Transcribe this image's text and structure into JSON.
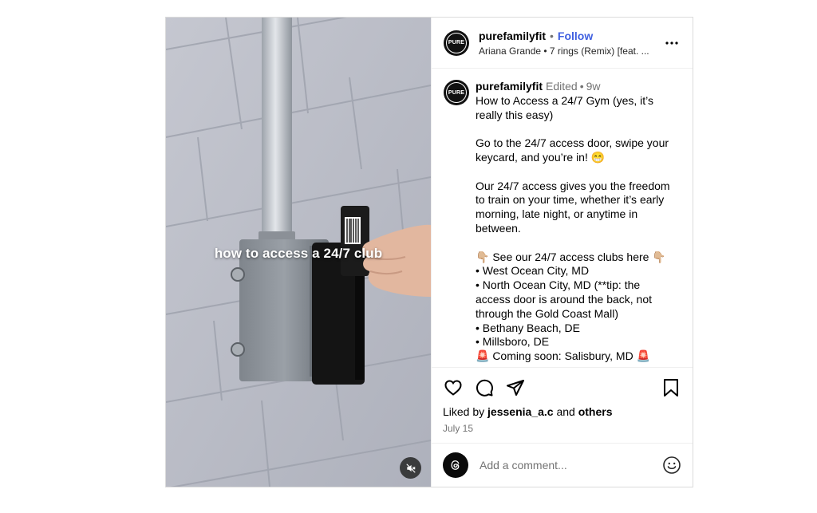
{
  "post": {
    "video_overlay_text": "how to access a 24/7 club",
    "media_icons": {
      "mute": "speaker-muted-icon"
    }
  },
  "header": {
    "username": "purefamilyfit",
    "separator": "•",
    "follow_label": "Follow",
    "audio": "Ariana Grande • 7 rings (Remix) [feat. ...",
    "avatar_logo_text": "PURE",
    "more_icon": "more-horizontal-icon"
  },
  "caption": {
    "username": "purefamilyfit",
    "edited": "Edited",
    "separator": "•",
    "time": "9w",
    "lines": [
      "How to Access a 24/7 Gym (yes, it’s really this easy)",
      "",
      "Go to the 24/7 access door, swipe your keycard, and you’re in! 😁",
      "",
      "Our 24/7 access gives you the freedom to train on your time, whether it’s early morning, late night, or anytime in between.",
      "",
      "👇🏼 See our 24/7 access clubs here 👇🏼",
      "• West Ocean City, MD",
      "• North Ocean City, MD (**tip: the access door is around the back, not through the Gold Coast Mall)",
      "• Bethany Beach, DE",
      "• Millsboro, DE",
      "🚨 Coming soon: Salisbury, MD 🚨"
    ]
  },
  "actions": {
    "icons": [
      "heart-icon",
      "comment-icon",
      "share-icon",
      "bookmark-icon"
    ],
    "liked_by_prefix": "Liked by",
    "liked_by_user": "jessenia_a.c",
    "liked_by_and": "and",
    "liked_by_others": "others",
    "date": "July 15"
  },
  "add_comment": {
    "placeholder": "Add a comment...",
    "emoji_icon": "smiley-icon"
  },
  "colors": {
    "follow": "#3f5fe0",
    "border": "#dbdbdb",
    "muted_text": "#737373"
  }
}
